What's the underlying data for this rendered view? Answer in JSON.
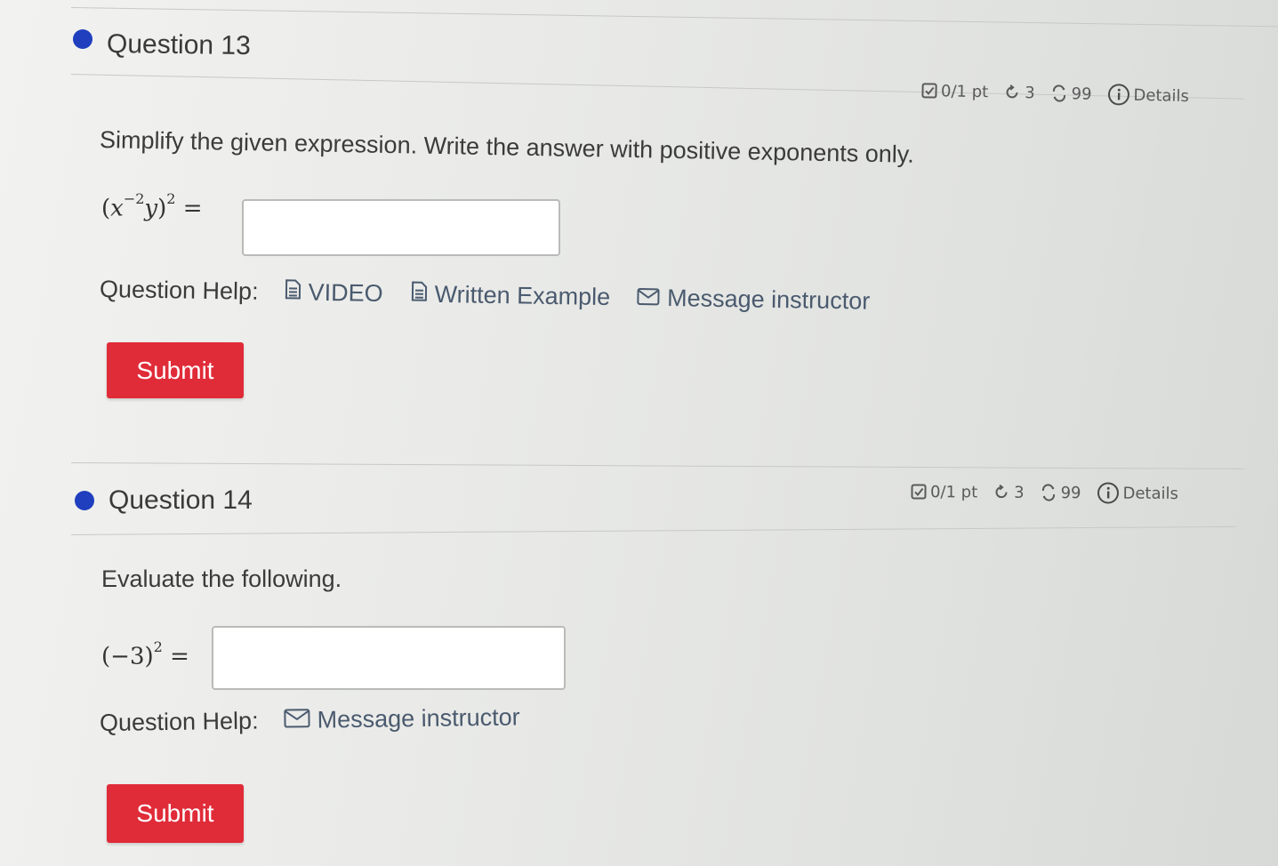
{
  "q13": {
    "title": "Question 13",
    "meta": {
      "points": "0/1 pt",
      "retries": "3",
      "attempts": "99",
      "details": "Details"
    },
    "prompt": "Simplify the given expression. Write the answer with positive exponents only.",
    "expr": {
      "base": "x",
      "inner_exp": "−2",
      "var": "y",
      "outer_exp": "2"
    },
    "answer_value": "",
    "help_label": "Question Help:",
    "help_links": {
      "video": "VIDEO",
      "written": "Written Example",
      "message": "Message instructor"
    },
    "submit": "Submit"
  },
  "q14": {
    "title": "Question 14",
    "meta": {
      "points": "0/1 pt",
      "retries": "3",
      "attempts": "99",
      "details": "Details"
    },
    "prompt": "Evaluate the following.",
    "expr": {
      "inner": "−3",
      "outer_exp": "2"
    },
    "answer_value": "",
    "help_label": "Question Help:",
    "help_links": {
      "message": "Message instructor"
    },
    "submit": "Submit"
  },
  "colors": {
    "accent_dot": "#1f3fbf",
    "submit_bg": "#e02b38",
    "link_text": "#4a5a6e"
  },
  "icons": [
    "checkbox-icon",
    "retry-icon",
    "attempts-icon",
    "info-icon",
    "document-icon",
    "envelope-icon"
  ]
}
